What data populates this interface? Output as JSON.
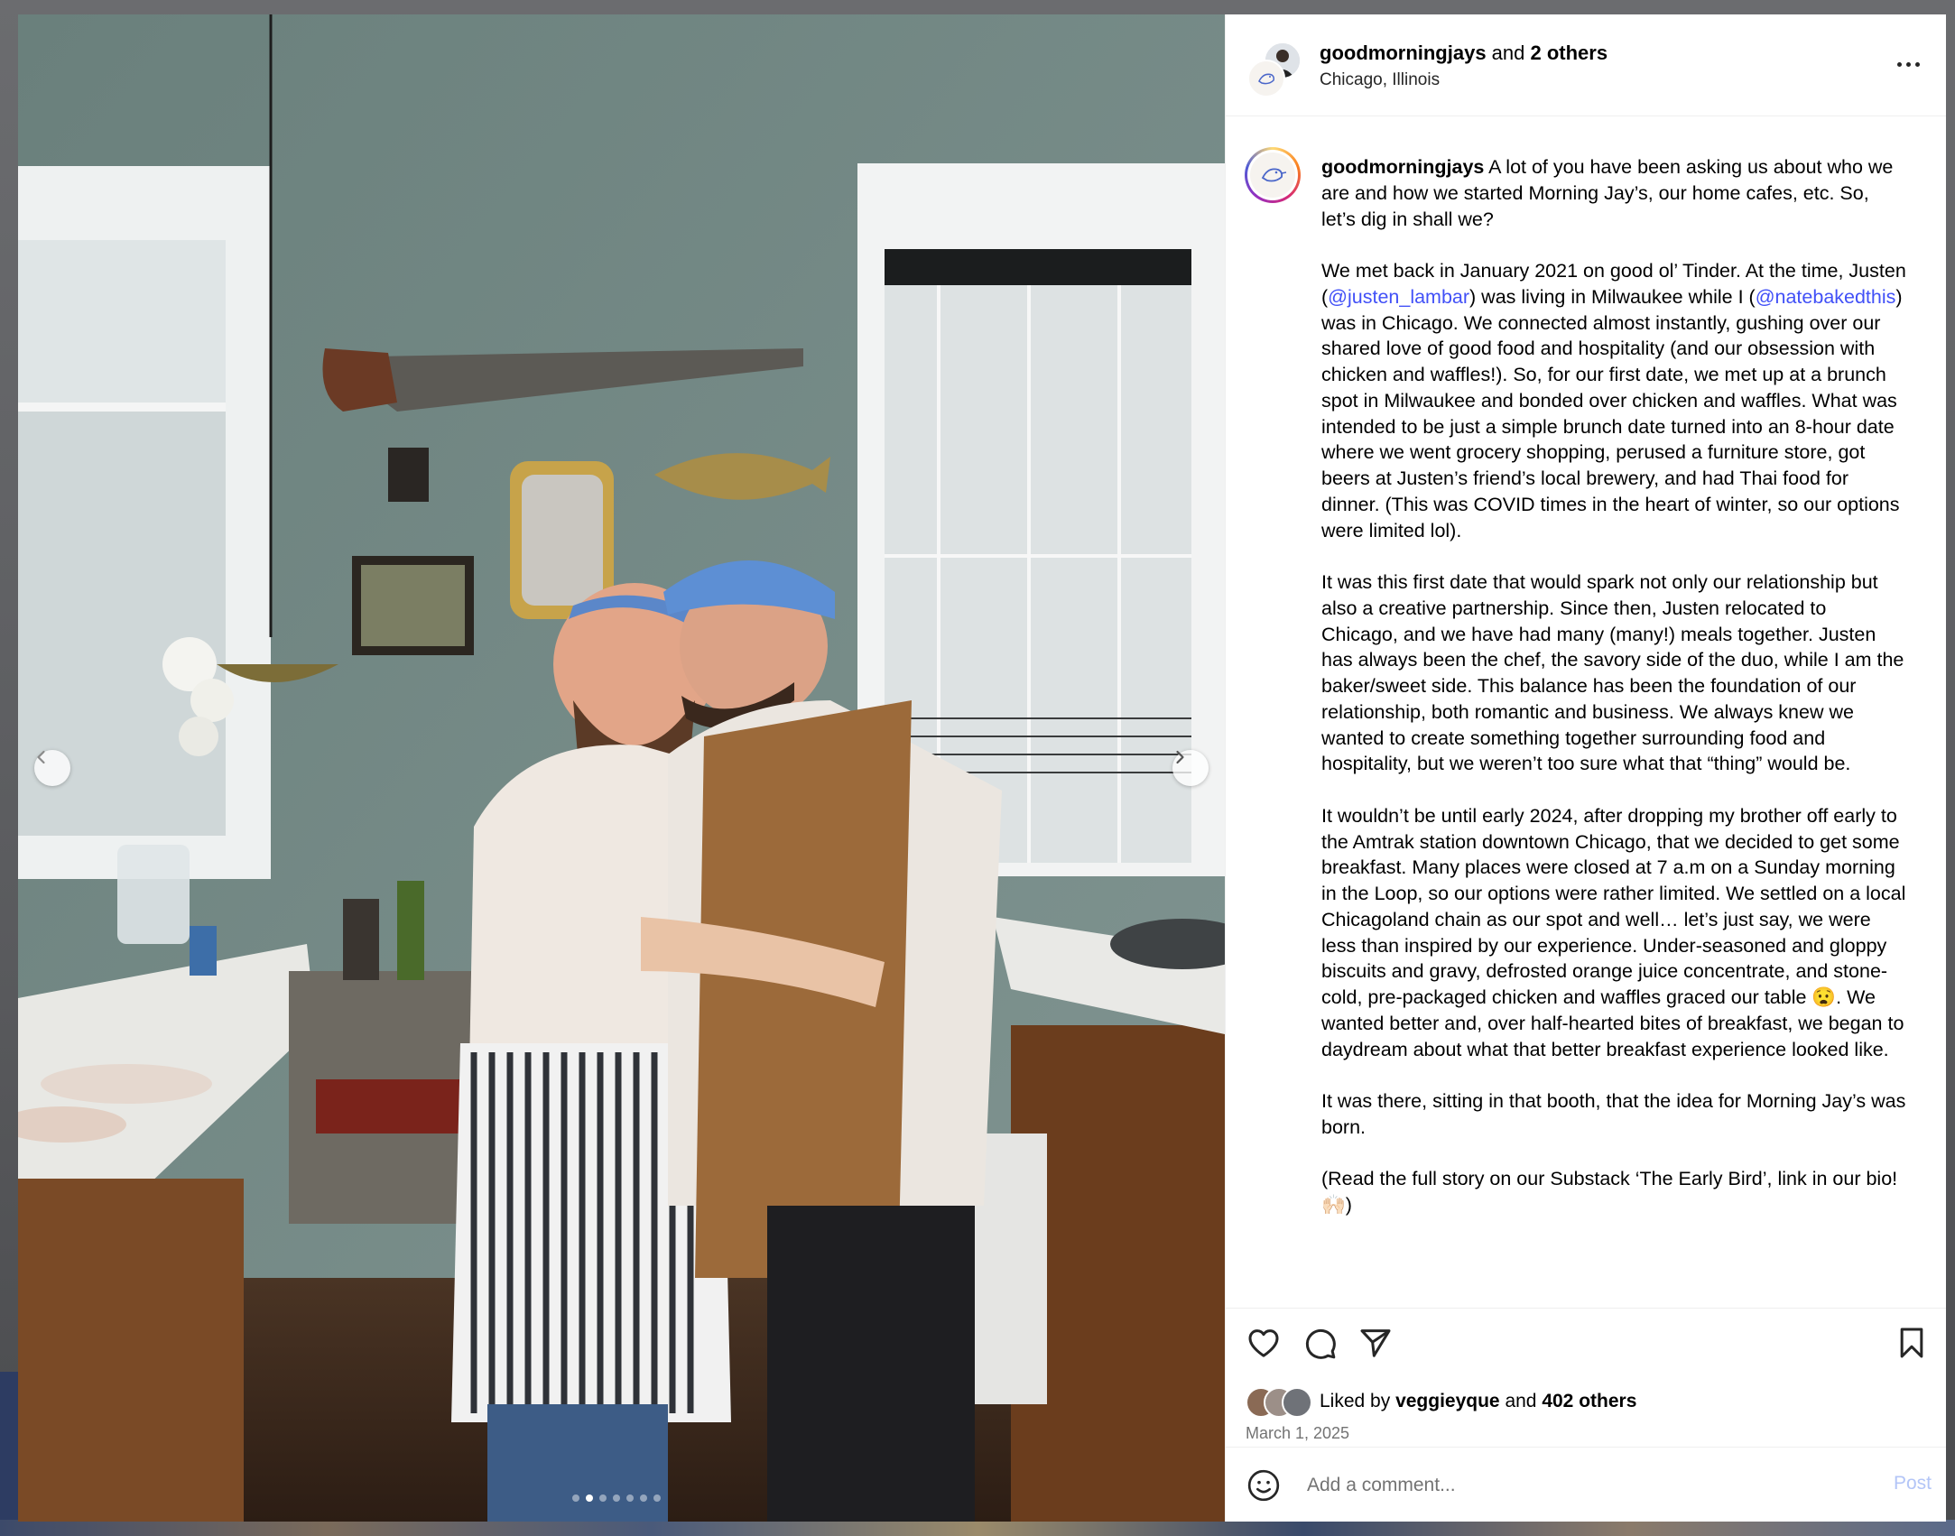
{
  "header": {
    "username": "goodmorningjays",
    "and_text": " and ",
    "others": "2 others",
    "location": "Chicago, Illinois"
  },
  "caption": {
    "username": "goodmorningjays",
    "p1": " A lot of you have been asking us about who we are and how we started Morning Jay’s, our home cafes, etc. So, let’s dig in shall we?",
    "p2_a": "We met back in January 2021 on good ol’ Tinder. At the time, Justen (",
    "mention1": "@justen_lambar",
    "p2_b": ") was living in Milwaukee while I (",
    "mention2": "@natebakedthis",
    "p2_c": ") was in Chicago. We connected almost instantly, gushing over our shared love of good food and hospitality (and our obsession with chicken and waffles!). So, for our first date, we met up at a brunch spot in Milwaukee and bonded over chicken and waffles. What was intended to be just a simple brunch date turned into an 8-hour date where we went grocery shopping, perused a furniture store, got beers at Justen’s friend’s local brewery, and had Thai food for dinner. (This was COVID times in the heart of winter, so our options were limited lol).",
    "p3": "It was this first date that would spark not only our relationship but also a creative partnership. Since then, Justen relocated to Chicago, and we have had many (many!) meals together. Justen has always been the chef, the savory side of the duo, while I am the baker/sweet side. This balance has been the foundation of our relationship, both romantic and business. We always knew we wanted to create something together surrounding food and hospitality, but we weren’t too sure what that “thing” would be.",
    "p4": "It wouldn’t be until early 2024, after dropping my brother off early to the Amtrak station downtown Chicago, that we decided to get some breakfast. Many places were closed at 7 a.m on a Sunday morning in the Loop, so our options were rather limited. We settled on a local Chicagoland chain as our spot and well… let’s just say, we were less than inspired by our experience. Under-seasoned and gloppy biscuits and gravy, defrosted orange juice concentrate, and stone-cold, pre-packaged chicken and waffles graced our table 😧. We wanted better and, over half-hearted bites of breakfast, we began to daydream about what that better breakfast experience looked like.",
    "p5": "It was there, sitting in that booth, that the idea for Morning Jay’s was born.",
    "p6": "(Read the full story on our Substack ‘The Early Bird’, link in our bio! 🙌🏻)"
  },
  "likes": {
    "prefix": "Liked by ",
    "user": "veggieyque",
    "middle": " and ",
    "count": "402 others"
  },
  "date": "March 1, 2025",
  "comment": {
    "placeholder": "Add a comment...",
    "post_label": "Post"
  },
  "carousel": {
    "count": 7,
    "active_index": 1
  },
  "icons": {
    "prev": "chevron-left-icon",
    "next": "chevron-right-icon",
    "like": "heart-icon",
    "comment": "comment-bubble-icon",
    "share": "paper-plane-icon",
    "save": "bookmark-icon",
    "more": "ellipsis-icon",
    "emoji": "smiley-icon"
  },
  "colors": {
    "mention": "#4150f7",
    "post_disabled": "#b3c5f7",
    "muted": "#737373"
  }
}
